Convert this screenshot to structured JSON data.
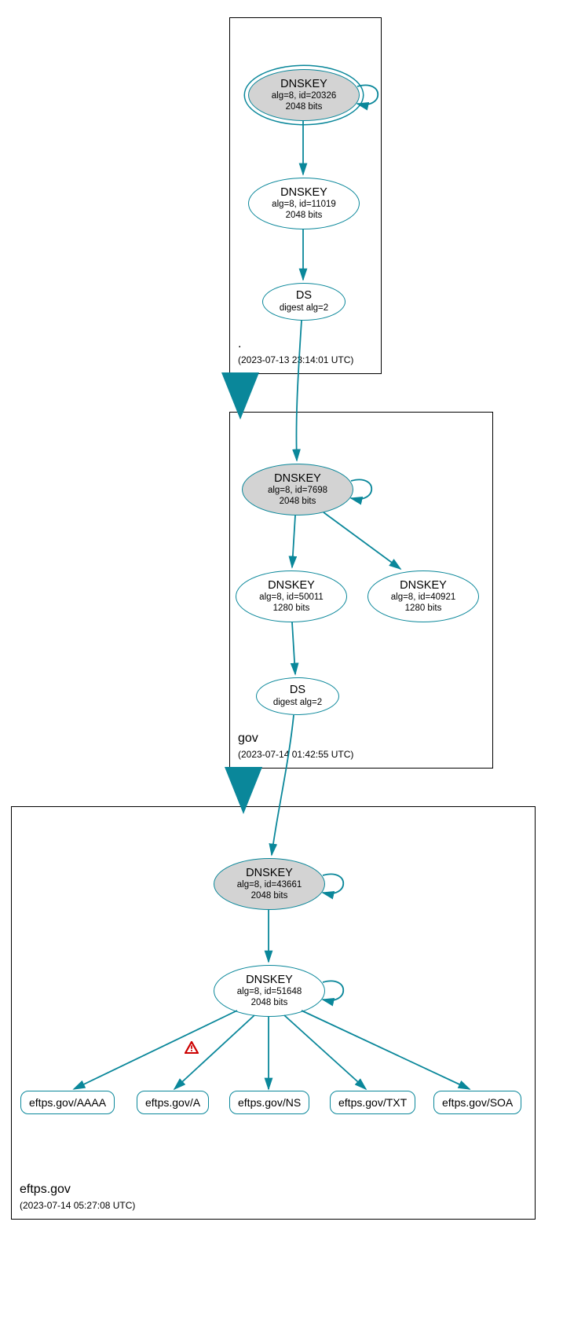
{
  "zones": {
    "root": {
      "label": ".",
      "timestamp": "(2023-07-13 23:14:01 UTC)"
    },
    "gov": {
      "label": "gov",
      "timestamp": "(2023-07-14 01:42:55 UTC)"
    },
    "eftps": {
      "label": "eftps.gov",
      "timestamp": "(2023-07-14 05:27:08 UTC)"
    }
  },
  "nodes": {
    "root_ksk": {
      "title": "DNSKEY",
      "sub1": "alg=8, id=20326",
      "sub2": "2048 bits"
    },
    "root_zsk": {
      "title": "DNSKEY",
      "sub1": "alg=8, id=11019",
      "sub2": "2048 bits"
    },
    "root_ds": {
      "title": "DS",
      "sub1": "digest alg=2"
    },
    "gov_ksk": {
      "title": "DNSKEY",
      "sub1": "alg=8, id=7698",
      "sub2": "2048 bits"
    },
    "gov_zsk1": {
      "title": "DNSKEY",
      "sub1": "alg=8, id=50011",
      "sub2": "1280 bits"
    },
    "gov_zsk2": {
      "title": "DNSKEY",
      "sub1": "alg=8, id=40921",
      "sub2": "1280 bits"
    },
    "gov_ds": {
      "title": "DS",
      "sub1": "digest alg=2"
    },
    "eftps_ksk": {
      "title": "DNSKEY",
      "sub1": "alg=8, id=43661",
      "sub2": "2048 bits"
    },
    "eftps_zsk": {
      "title": "DNSKEY",
      "sub1": "alg=8, id=51648",
      "sub2": "2048 bits"
    },
    "rr_aaaa": {
      "label": "eftps.gov/AAAA"
    },
    "rr_a": {
      "label": "eftps.gov/A"
    },
    "rr_ns": {
      "label": "eftps.gov/NS"
    },
    "rr_txt": {
      "label": "eftps.gov/TXT"
    },
    "rr_soa": {
      "label": "eftps.gov/SOA"
    }
  },
  "colors": {
    "stroke": "#0a879a",
    "fill_grey": "#d3d3d3",
    "warning": "#cc0000"
  }
}
